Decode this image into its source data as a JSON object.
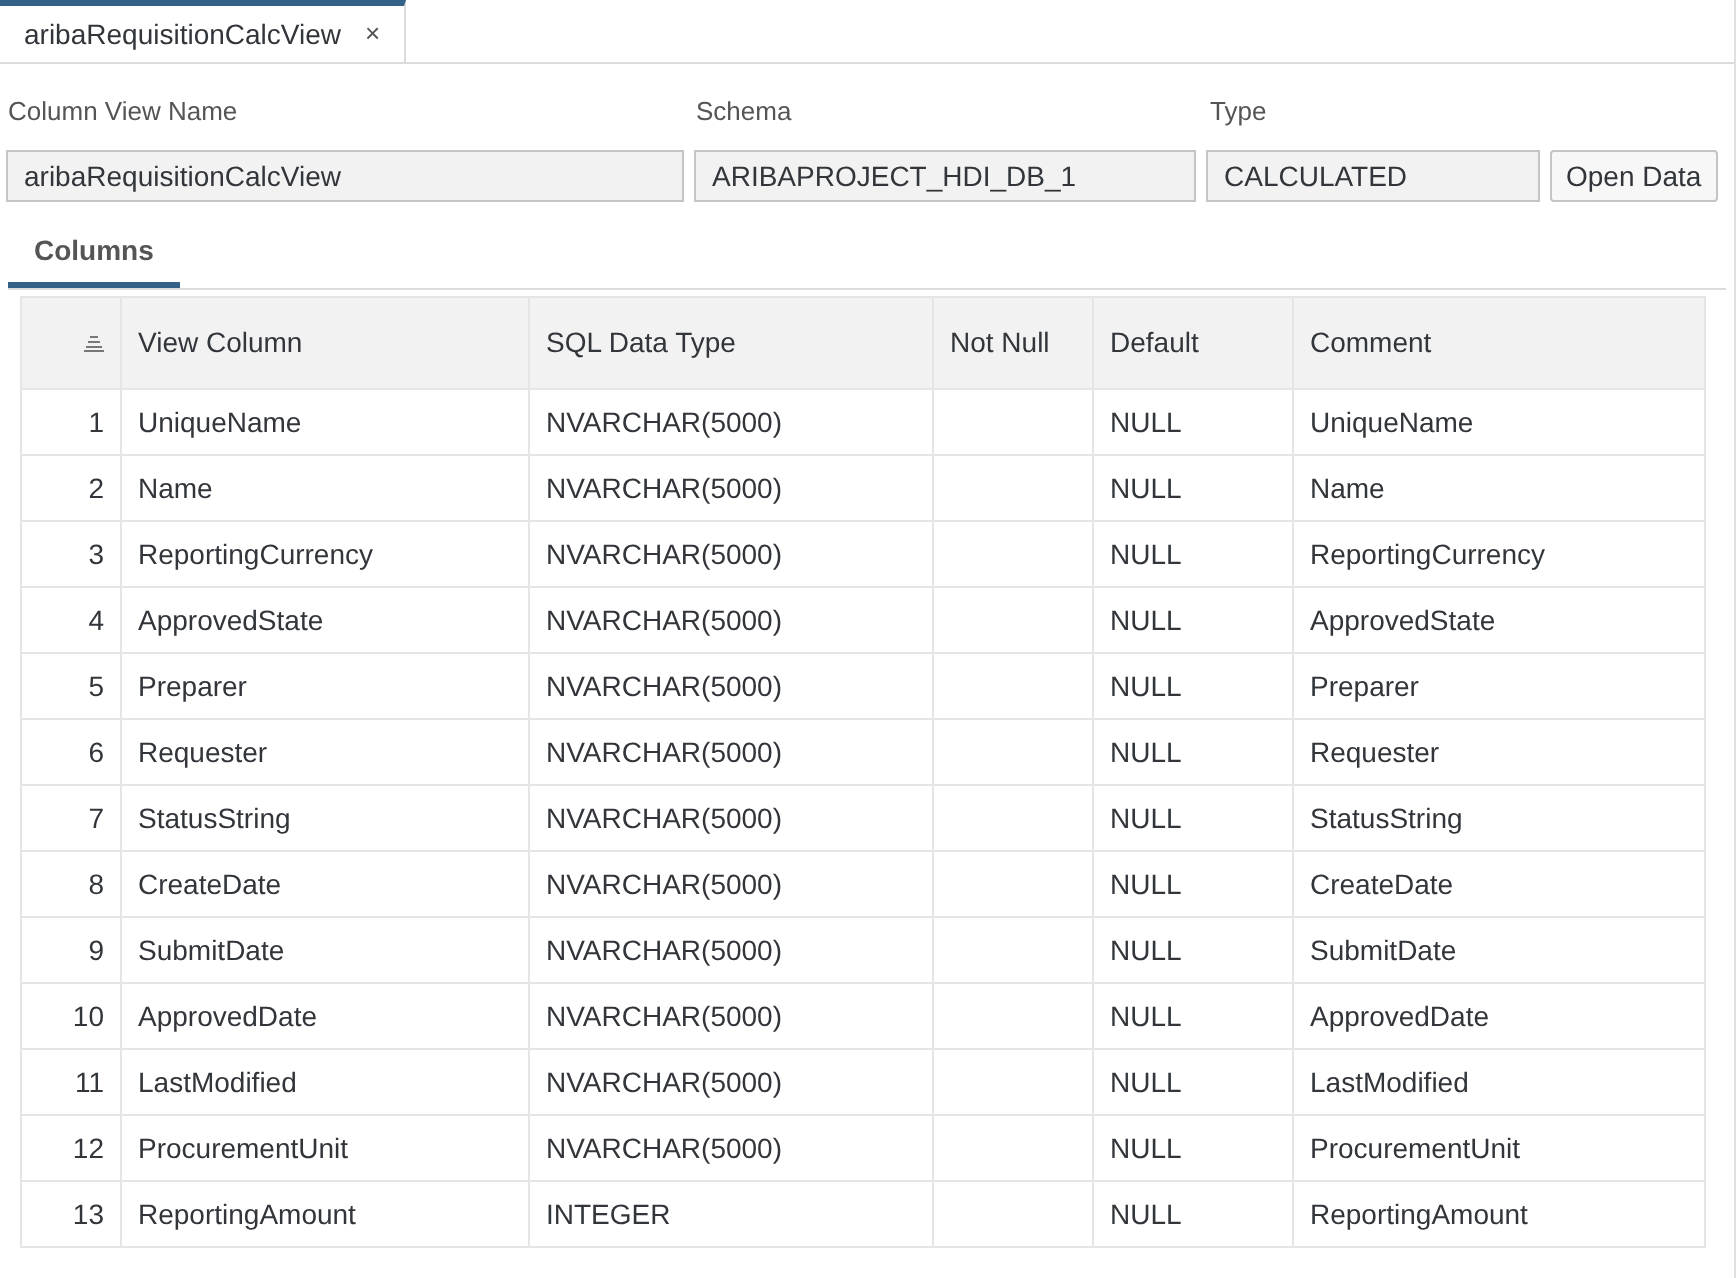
{
  "tabs": [
    {
      "label": "aribaRequisitionCalcView",
      "close": "×",
      "selected": true
    }
  ],
  "fields": [
    {
      "label": "Column View Name",
      "value": "aribaRequisitionCalcView"
    },
    {
      "label": "Schema",
      "value": "ARIBAPROJECT_HDI_DB_1"
    },
    {
      "label": "Type",
      "value": "CALCULATED"
    }
  ],
  "open_button": "Open Data",
  "section_tabs": [
    {
      "label": "Columns",
      "selected": true
    }
  ],
  "table": {
    "columns": [
      "View Column",
      "SQL Data Type",
      "Not Null",
      "Default",
      "Comment"
    ],
    "rows": [
      {
        "index": "1",
        "view_column": "UniqueName",
        "sql_type": "NVARCHAR(5000)",
        "default": "NULL",
        "comment": "UniqueName"
      },
      {
        "index": "2",
        "view_column": "Name",
        "sql_type": "NVARCHAR(5000)",
        "default": "NULL",
        "comment": "Name"
      },
      {
        "index": "3",
        "view_column": "ReportingCurrency",
        "sql_type": "NVARCHAR(5000)",
        "default": "NULL",
        "comment": "ReportingCurrency"
      },
      {
        "index": "4",
        "view_column": "ApprovedState",
        "sql_type": "NVARCHAR(5000)",
        "default": "NULL",
        "comment": "ApprovedState"
      },
      {
        "index": "5",
        "view_column": "Preparer",
        "sql_type": "NVARCHAR(5000)",
        "default": "NULL",
        "comment": "Preparer"
      },
      {
        "index": "6",
        "view_column": "Requester",
        "sql_type": "NVARCHAR(5000)",
        "default": "NULL",
        "comment": "Requester"
      },
      {
        "index": "7",
        "view_column": "StatusString",
        "sql_type": "NVARCHAR(5000)",
        "default": "NULL",
        "comment": "StatusString"
      },
      {
        "index": "8",
        "view_column": "CreateDate",
        "sql_type": "NVARCHAR(5000)",
        "default": "NULL",
        "comment": "CreateDate"
      },
      {
        "index": "9",
        "view_column": "SubmitDate",
        "sql_type": "NVARCHAR(5000)",
        "default": "NULL",
        "comment": "SubmitDate"
      },
      {
        "index": "10",
        "view_column": "ApprovedDate",
        "sql_type": "NVARCHAR(5000)",
        "default": "NULL",
        "comment": "ApprovedDate"
      },
      {
        "index": "11",
        "view_column": "LastModified",
        "sql_type": "NVARCHAR(5000)",
        "default": "NULL",
        "comment": "LastModified"
      },
      {
        "index": "12",
        "view_column": "ProcurementUnit",
        "sql_type": "NVARCHAR(5000)",
        "default": "NULL",
        "comment": "ProcurementUnit"
      },
      {
        "index": "13",
        "view_column": "ReportingAmount",
        "sql_type": "INTEGER",
        "default": "NULL",
        "comment": "ReportingAmount"
      }
    ]
  }
}
